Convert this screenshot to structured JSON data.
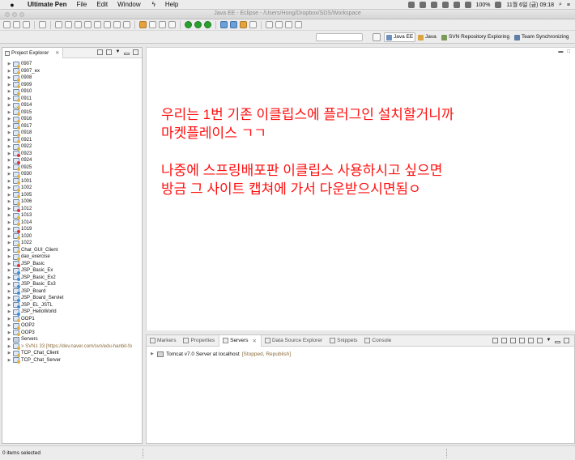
{
  "menubar": {
    "app_name": "Ultimate Pen",
    "menus": [
      "File",
      "Edit",
      "Window",
      "Help"
    ],
    "battery": "100%",
    "clock": "11월 6일 (금)  09:18"
  },
  "window": {
    "title": "Java EE - Eclipse - /Users/Hong/Dropbox/SDS/Workspace"
  },
  "perspectives": [
    {
      "label": "Java EE",
      "active": true,
      "color": "#6b8fbf"
    },
    {
      "label": "Java",
      "active": false,
      "color": "#d9a441"
    },
    {
      "label": "SVN Repository Exploring",
      "active": false,
      "color": "#7a9a5a"
    },
    {
      "label": "Team Synchronizing",
      "active": false,
      "color": "#5d7fa8"
    }
  ],
  "explorer": {
    "tab_label": "Project Explorer",
    "tab_close": "✕",
    "items": [
      {
        "label": "0907",
        "kind": "proj"
      },
      {
        "label": "0907_ex",
        "kind": "proj"
      },
      {
        "label": "0908",
        "kind": "proj"
      },
      {
        "label": "0909",
        "kind": "proj"
      },
      {
        "label": "0910",
        "kind": "proj"
      },
      {
        "label": "0911",
        "kind": "proj"
      },
      {
        "label": "0914",
        "kind": "proj"
      },
      {
        "label": "0915",
        "kind": "proj"
      },
      {
        "label": "0916",
        "kind": "proj"
      },
      {
        "label": "0917",
        "kind": "proj"
      },
      {
        "label": "0918",
        "kind": "proj"
      },
      {
        "label": "0921",
        "kind": "proj"
      },
      {
        "label": "0922",
        "kind": "proj"
      },
      {
        "label": "0923",
        "kind": "err"
      },
      {
        "label": "0924",
        "kind": "err"
      },
      {
        "label": "0925",
        "kind": "proj"
      },
      {
        "label": "0930",
        "kind": "proj"
      },
      {
        "label": "1001",
        "kind": "proj"
      },
      {
        "label": "1002",
        "kind": "proj"
      },
      {
        "label": "1005",
        "kind": "proj"
      },
      {
        "label": "1006",
        "kind": "proj"
      },
      {
        "label": "1012",
        "kind": "err"
      },
      {
        "label": "1013",
        "kind": "proj"
      },
      {
        "label": "1014",
        "kind": "proj"
      },
      {
        "label": "1019",
        "kind": "err"
      },
      {
        "label": "1020",
        "kind": "proj"
      },
      {
        "label": "1022",
        "kind": "proj"
      },
      {
        "label": "Chat_GUI_Client",
        "kind": "proj"
      },
      {
        "label": "dao_exercise",
        "kind": "proj"
      },
      {
        "label": "JSP_Basic",
        "kind": "err"
      },
      {
        "label": "JSP_Basic_Ex",
        "kind": "web"
      },
      {
        "label": "JSP_Basic_Ex2",
        "kind": "web"
      },
      {
        "label": "JSP_Basic_Ex3",
        "kind": "web"
      },
      {
        "label": "JSP_Board",
        "kind": "web"
      },
      {
        "label": "JSP_Board_Servlet",
        "kind": "web"
      },
      {
        "label": "JSP_EL_JSTL",
        "kind": "web"
      },
      {
        "label": "JSP_HelloWorld",
        "kind": "web"
      },
      {
        "label": "OOP1",
        "kind": "proj"
      },
      {
        "label": "OOP2",
        "kind": "proj"
      },
      {
        "label": "OOP3",
        "kind": "proj"
      },
      {
        "label": "Servers",
        "kind": "srv"
      },
      {
        "label": "> SVN1 33 [https://dev.naver.com/svn/edu-hanbit-fo",
        "kind": "proj"
      },
      {
        "label": "TCP_Chat_Client",
        "kind": "proj"
      },
      {
        "label": "TCP_Chat_Server",
        "kind": "proj"
      }
    ]
  },
  "annotation": {
    "lines": [
      "우리는 1번 기존 이클립스에 플러그인 설치할거니까",
      "마켓플레이스 ㄱㄱ",
      "",
      "나중에 스프링배포판 이클립스 사용하시고 싶으면",
      "방금 그 사이트 캡쳐에 가서 다운받으시면됨ㅇ"
    ],
    "color": "#ff0f0f"
  },
  "bottom_panel": {
    "tabs": [
      {
        "label": "Markers",
        "active": false
      },
      {
        "label": "Properties",
        "active": false
      },
      {
        "label": "Servers",
        "active": true
      },
      {
        "label": "Data Source Explorer",
        "active": false
      },
      {
        "label": "Snippets",
        "active": false
      },
      {
        "label": "Console",
        "active": false
      }
    ],
    "tab_close": "✕",
    "server": {
      "name": "Tomcat v7.0 Server at localhost",
      "status": "[Stopped, Republish]"
    }
  },
  "statusbar": {
    "message": "0 items selected"
  }
}
